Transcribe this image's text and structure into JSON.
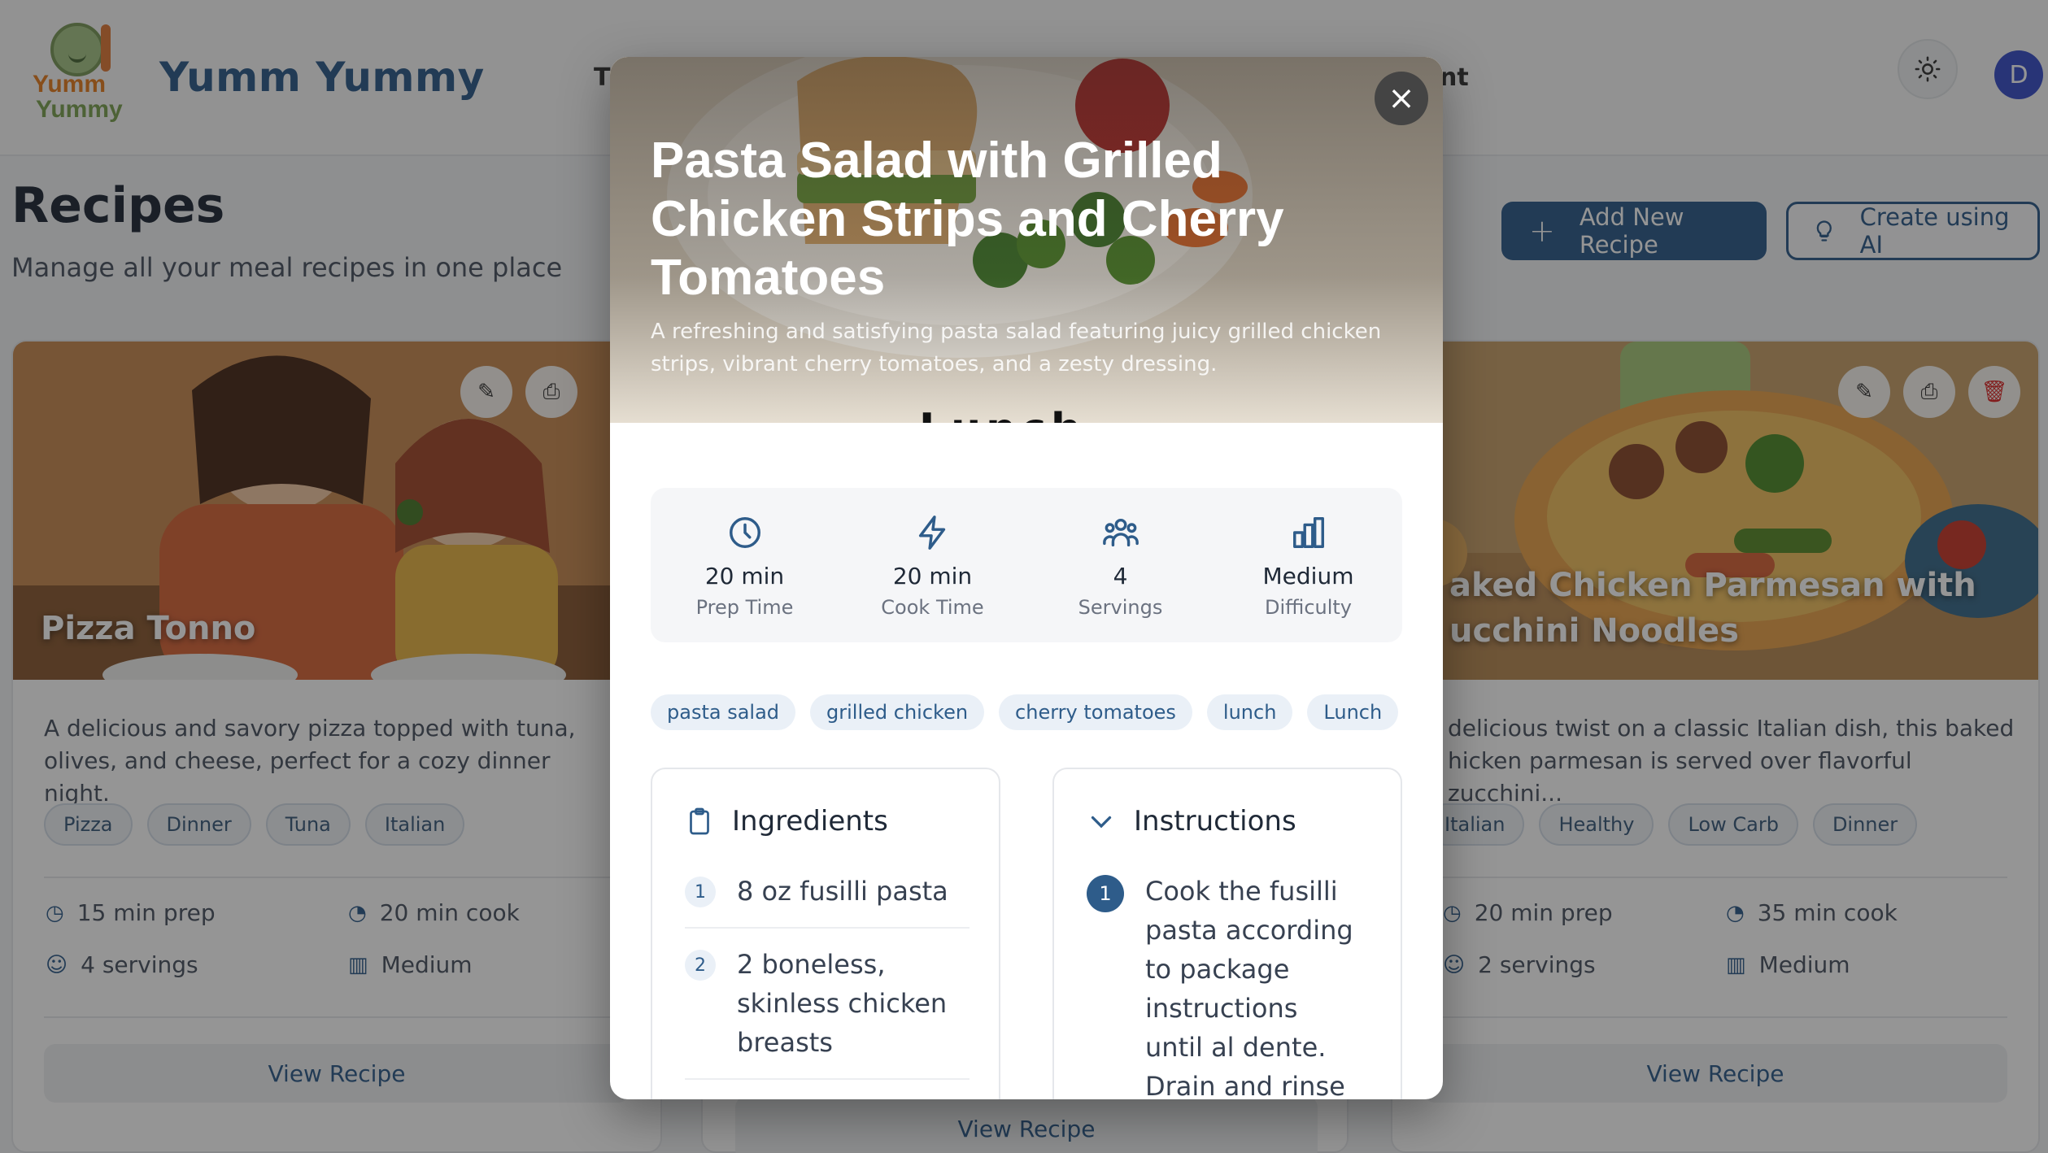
{
  "app": {
    "brand": "Yumm Yummy",
    "logo_text_line1": "Yumm",
    "logo_text_line2": "Yummy",
    "nav_left_partial": "T",
    "nav_right_partial": "nt",
    "avatar_initial": "D",
    "theme_icon": "sun-icon"
  },
  "page": {
    "title": "Recipes",
    "subtitle": "Manage all your meal recipes in one place",
    "add_button": "Add New Recipe",
    "ai_button": "Create using AI"
  },
  "cards": [
    {
      "title": "Pizza Tonno",
      "description": "A delicious and savory pizza topped with tuna, olives, and cheese, perfect for a cozy dinner night.",
      "tags": [
        "Pizza",
        "Dinner",
        "Tuna",
        "Italian"
      ],
      "prep": "15 min prep",
      "cook": "20 min cook",
      "servings": "4 servings",
      "difficulty": "Medium",
      "view": "View Recipe"
    },
    {
      "title": "aked Chicken Parmesan with ucchini Noodles",
      "description": "delicious twist on a classic Italian dish, this baked hicken parmesan is served over flavorful zucchini...",
      "tags": [
        "Italian",
        "Healthy",
        "Low Carb",
        "Dinner"
      ],
      "prep": "20 min prep",
      "cook": "35 min cook",
      "servings": "2 servings",
      "difficulty": "Medium",
      "view": "View Recipe"
    }
  ],
  "middle_card": {
    "view": "View Recipe"
  },
  "modal": {
    "title": "Pasta Salad with Grilled Chicken Strips and Cherry Tomatoes",
    "description": "A refreshing and satisfying pasta salad featuring juicy grilled chicken strips, vibrant cherry tomatoes, and a zesty dressing.",
    "hero_cut_text": "Lunch",
    "close_label": "×",
    "stats": [
      {
        "icon": "clock-icon",
        "value": "20 min",
        "label": "Prep Time"
      },
      {
        "icon": "lightning-icon",
        "value": "20 min",
        "label": "Cook Time"
      },
      {
        "icon": "users-icon",
        "value": "4",
        "label": "Servings"
      },
      {
        "icon": "bar-chart-icon",
        "value": "Medium",
        "label": "Difficulty"
      }
    ],
    "tags": [
      "pasta salad",
      "grilled chicken",
      "cherry tomatoes",
      "lunch",
      "Lunch"
    ],
    "ingredients": {
      "title": "Ingredients",
      "items": [
        {
          "num": "1",
          "text": "8 oz fusilli pasta"
        },
        {
          "num": "2",
          "text": "2 boneless, skinless chicken breasts"
        }
      ]
    },
    "instructions": {
      "title": "Instructions",
      "items": [
        {
          "num": "1",
          "text": "Cook the fusilli pasta according to package instructions until al dente. Drain and rinse under"
        }
      ]
    }
  },
  "colors": {
    "primary": "#2e5c8a",
    "danger": "#dc2626",
    "tag_bg": "#eaf0f7"
  }
}
